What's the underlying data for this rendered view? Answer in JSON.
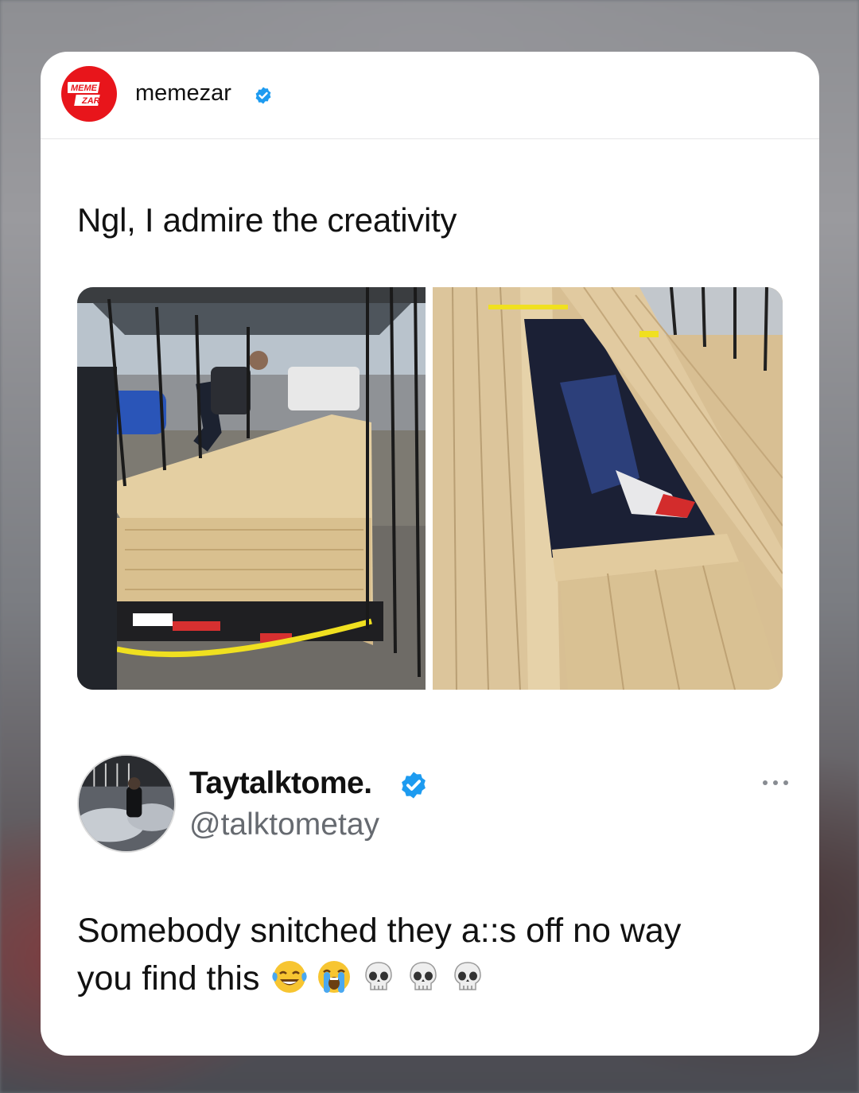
{
  "post": {
    "account_name": "memezar",
    "account_logo_text": [
      "MEME",
      "ZAR"
    ],
    "caption": "Ngl, I admire the creativity"
  },
  "tweet": {
    "display_name": "Taytalktome.",
    "handle": "@talktometay",
    "text_line1": "Somebody snitched they a::s off no way",
    "text_line2": "you find this",
    "emojis": [
      "face-with-tears-of-joy",
      "loudly-crying-face",
      "skull",
      "skull",
      "skull"
    ]
  },
  "colors": {
    "brand_red": "#e8151b",
    "verified_blue": "#1d9bf0",
    "handle_gray": "#666a70"
  }
}
